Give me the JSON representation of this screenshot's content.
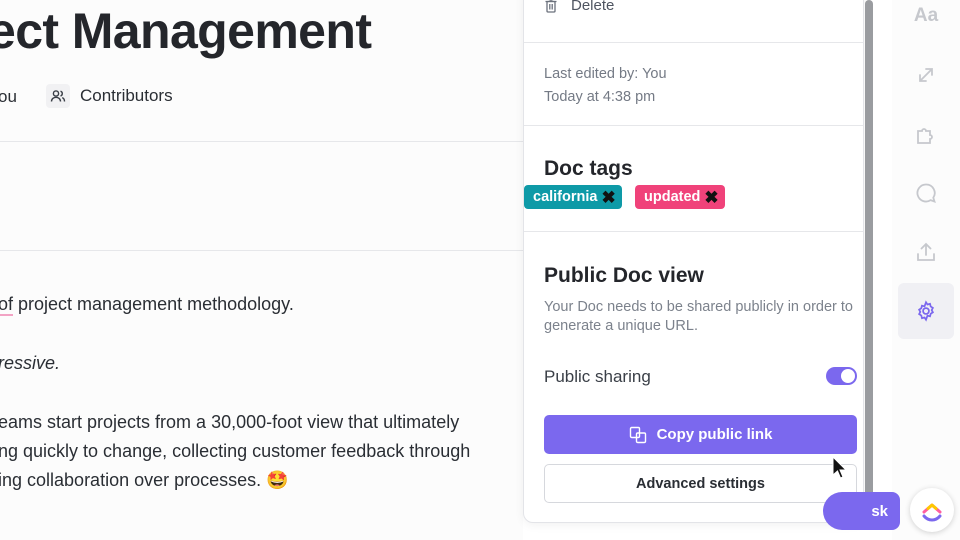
{
  "document": {
    "title": "ect Management",
    "meta_you": "ou",
    "contributors_label": "Contributors",
    "lines": [
      {
        "pre": "of",
        "text": " project management methodology."
      },
      {
        "text": "ressive."
      },
      {
        "text": "eams start projects from a 30,000-foot view that ultimately"
      },
      {
        "text": "ng quickly to change, collecting customer feedback through"
      },
      {
        "text": "ing collaboration over processes. 🤩"
      }
    ]
  },
  "panel": {
    "delete_label": "Delete",
    "last_edited_line1": "Last edited by: You",
    "last_edited_line2": "Today at 4:38 pm",
    "doc_tags_title": "Doc tags",
    "tags": [
      {
        "label": "california",
        "color": "#0e9aa7"
      },
      {
        "label": "updated",
        "color": "#f0427a"
      }
    ],
    "public_view_title": "Public Doc view",
    "public_view_desc": "Your Doc needs to be shared publicly in order to generate a unique URL.",
    "public_sharing_label": "Public sharing",
    "public_sharing_on": true,
    "copy_link_label": "Copy public link",
    "advanced_settings_label": "Advanced settings"
  },
  "rail": {
    "font_icon_text": "Aa",
    "icons": [
      "font-icon",
      "relationships-icon",
      "puzzle-icon",
      "comment-icon",
      "upload-icon",
      "gear-icon"
    ]
  },
  "fab": {
    "task_label": "sk"
  },
  "colors": {
    "accent": "#7b68ee",
    "tag_california": "#0e9aa7",
    "tag_updated": "#f0427a"
  }
}
